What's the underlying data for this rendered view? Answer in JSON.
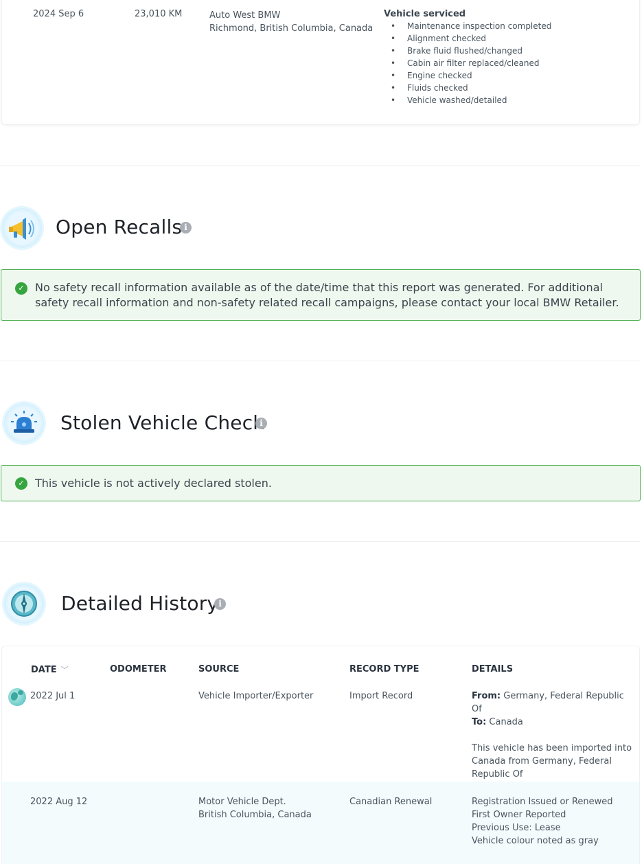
{
  "service_record": {
    "date": "2024 Sep 6",
    "odometer": "23,010 KM",
    "source_line1": "Auto West BMW",
    "source_line2": "Richmond, British Columbia, Canada",
    "title": "Vehicle serviced",
    "items": [
      "Maintenance inspection completed",
      "Alignment checked",
      "Brake fluid flushed/changed",
      "Cabin air filter replaced/cleaned",
      "Engine checked",
      "Fluids checked",
      "Vehicle washed/detailed"
    ]
  },
  "open_recalls": {
    "title": "Open Recalls",
    "icon": "megaphone-icon",
    "message": "No safety recall information available as of the date/time that this report was generated. For additional safety recall information and non-safety related recall campaigns, please contact your local BMW Retailer."
  },
  "stolen_check": {
    "title": "Stolen Vehicle Check",
    "icon": "siren-icon",
    "message": "This vehicle is not actively declared stolen."
  },
  "detailed_history": {
    "title": "Detailed History",
    "icon": "compass-icon",
    "columns": [
      "DATE",
      "ODOMETER",
      "SOURCE",
      "RECORD TYPE",
      "DETAILS"
    ],
    "rows": [
      {
        "date": "2022 Jul 1",
        "odometer": "",
        "source": "Vehicle Importer/Exporter",
        "record_type": "Import Record",
        "from_label": "From:",
        "from_value": "Germany, Federal Republic Of",
        "to_label": "To:",
        "to_value": "Canada",
        "note": "This vehicle has been imported into Canada from Germany, Federal Republic Of"
      },
      {
        "date": "2022 Aug 12",
        "odometer": "",
        "source_line1": "Motor Vehicle Dept.",
        "source_line2": "British Columbia, Canada",
        "record_type": "Canadian Renewal",
        "details": [
          "Registration Issued or Renewed",
          "First Owner Reported",
          "Previous Use: Lease",
          "Vehicle colour noted as gray"
        ]
      }
    ]
  },
  "colors": {
    "notice_border": "#4caf50",
    "notice_bg": "#eef8ee",
    "check_green": "#36a540",
    "row_highlight": "#f4fbfd"
  }
}
